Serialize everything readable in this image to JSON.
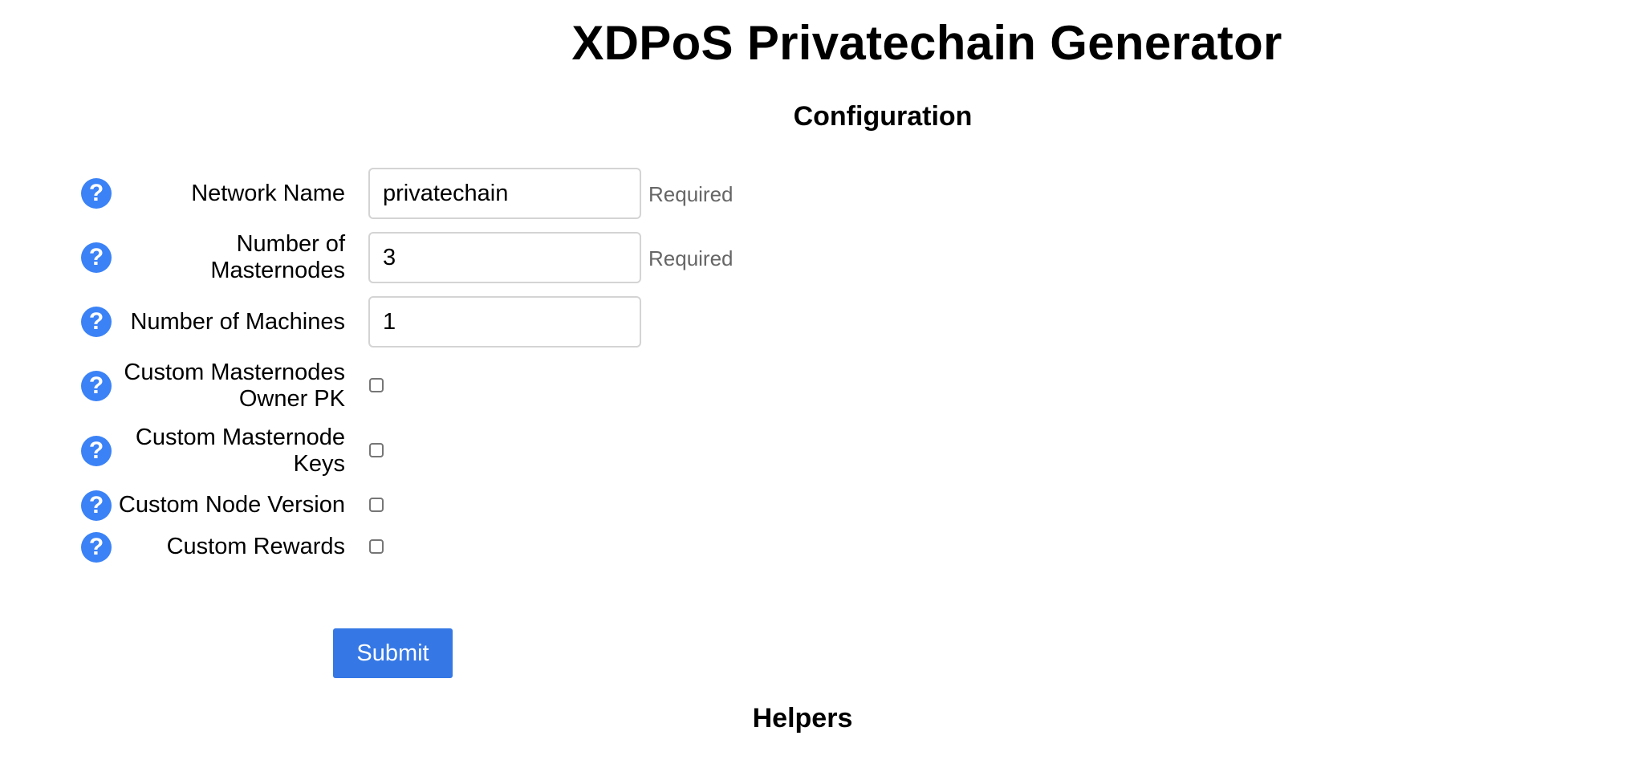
{
  "header": {
    "title": "XDPoS Privatechain Generator"
  },
  "config": {
    "title": "Configuration",
    "help_glyph": "?",
    "required_note": "Required",
    "fields": {
      "network_name": {
        "label": "Network Name",
        "value": "privatechain",
        "required": true
      },
      "num_masternodes": {
        "label_line1": "Number of",
        "label_line2": "Masternodes",
        "value": "3",
        "required": true
      },
      "num_machines": {
        "label": "Number of Machines",
        "value": "1"
      },
      "custom_owner_pk": {
        "label_line1": "Custom Masternodes",
        "label_line2": "Owner PK",
        "checked": false
      },
      "custom_masternode_keys": {
        "label_line1": "Custom Masternode",
        "label_line2": "Keys",
        "checked": false
      },
      "custom_node_version": {
        "label": "Custom Node Version",
        "checked": false
      },
      "custom_rewards": {
        "label": "Custom Rewards",
        "checked": false
      }
    },
    "submit_label": "Submit"
  },
  "helpers": {
    "title": "Helpers"
  },
  "colors": {
    "help_icon": "#3b82f6",
    "submit_button": "#3578e5",
    "required_text": "#666666",
    "input_border": "#d4d4d4"
  },
  "icons": {
    "help": "question-mark-circle-icon"
  }
}
